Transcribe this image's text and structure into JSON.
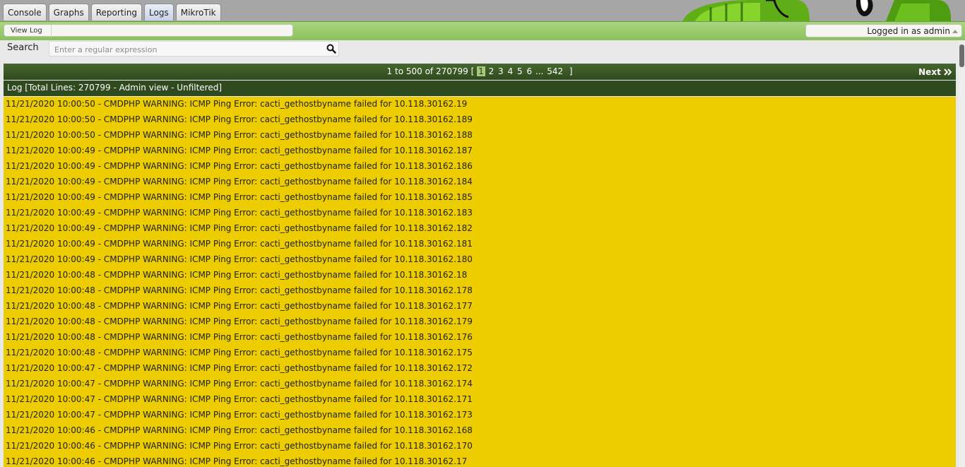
{
  "tabs": [
    {
      "label": "Console",
      "active": false
    },
    {
      "label": "Graphs",
      "active": false
    },
    {
      "label": "Reporting",
      "active": false
    },
    {
      "label": "Logs",
      "active": true
    },
    {
      "label": "MikroTik",
      "active": false
    }
  ],
  "breadcrumb": {
    "current": "View Log"
  },
  "user": {
    "status": "Logged in as admin"
  },
  "search": {
    "label": "Search",
    "placeholder": "Enter a regular expression"
  },
  "pager": {
    "range": "1 to 500 of 270799",
    "open_bracket": "[",
    "close_bracket": "]",
    "current_page": "1",
    "pages": [
      "2",
      "3",
      "4",
      "5",
      "6"
    ],
    "ellipsis": "...",
    "last_page": "542",
    "next_label": "Next"
  },
  "log": {
    "title": "Log [Total Lines: 270799 - Admin view - Unfiltered]",
    "lines": [
      "11/21/2020 10:00:50 - CMDPHP WARNING: ICMP Ping Error: cacti_gethostbyname failed for 10.118.30162.19",
      "11/21/2020 10:00:50 - CMDPHP WARNING: ICMP Ping Error: cacti_gethostbyname failed for 10.118.30162.189",
      "11/21/2020 10:00:50 - CMDPHP WARNING: ICMP Ping Error: cacti_gethostbyname failed for 10.118.30162.188",
      "11/21/2020 10:00:49 - CMDPHP WARNING: ICMP Ping Error: cacti_gethostbyname failed for 10.118.30162.187",
      "11/21/2020 10:00:49 - CMDPHP WARNING: ICMP Ping Error: cacti_gethostbyname failed for 10.118.30162.186",
      "11/21/2020 10:00:49 - CMDPHP WARNING: ICMP Ping Error: cacti_gethostbyname failed for 10.118.30162.184",
      "11/21/2020 10:00:49 - CMDPHP WARNING: ICMP Ping Error: cacti_gethostbyname failed for 10.118.30162.185",
      "11/21/2020 10:00:49 - CMDPHP WARNING: ICMP Ping Error: cacti_gethostbyname failed for 10.118.30162.183",
      "11/21/2020 10:00:49 - CMDPHP WARNING: ICMP Ping Error: cacti_gethostbyname failed for 10.118.30162.182",
      "11/21/2020 10:00:49 - CMDPHP WARNING: ICMP Ping Error: cacti_gethostbyname failed for 10.118.30162.181",
      "11/21/2020 10:00:49 - CMDPHP WARNING: ICMP Ping Error: cacti_gethostbyname failed for 10.118.30162.180",
      "11/21/2020 10:00:48 - CMDPHP WARNING: ICMP Ping Error: cacti_gethostbyname failed for 10.118.30162.18",
      "11/21/2020 10:00:48 - CMDPHP WARNING: ICMP Ping Error: cacti_gethostbyname failed for 10.118.30162.178",
      "11/21/2020 10:00:48 - CMDPHP WARNING: ICMP Ping Error: cacti_gethostbyname failed for 10.118.30162.177",
      "11/21/2020 10:00:48 - CMDPHP WARNING: ICMP Ping Error: cacti_gethostbyname failed for 10.118.30162.179",
      "11/21/2020 10:00:48 - CMDPHP WARNING: ICMP Ping Error: cacti_gethostbyname failed for 10.118.30162.176",
      "11/21/2020 10:00:48 - CMDPHP WARNING: ICMP Ping Error: cacti_gethostbyname failed for 10.118.30162.175",
      "11/21/2020 10:00:47 - CMDPHP WARNING: ICMP Ping Error: cacti_gethostbyname failed for 10.118.30162.172",
      "11/21/2020 10:00:47 - CMDPHP WARNING: ICMP Ping Error: cacti_gethostbyname failed for 10.118.30162.174",
      "11/21/2020 10:00:47 - CMDPHP WARNING: ICMP Ping Error: cacti_gethostbyname failed for 10.118.30162.171",
      "11/21/2020 10:00:47 - CMDPHP WARNING: ICMP Ping Error: cacti_gethostbyname failed for 10.118.30162.173",
      "11/21/2020 10:00:46 - CMDPHP WARNING: ICMP Ping Error: cacti_gethostbyname failed for 10.118.30162.168",
      "11/21/2020 10:00:46 - CMDPHP WARNING: ICMP Ping Error: cacti_gethostbyname failed for 10.118.30162.170",
      "11/21/2020 10:00:46 - CMDPHP WARNING: ICMP Ping Error: cacti_gethostbyname failed for 10.118.30162.17"
    ]
  },
  "icons": {
    "search": "search-icon",
    "next": "double-chevron-right-icon",
    "caret": "caret-up-icon",
    "logo": "cactus-logo-icon"
  },
  "colors": {
    "nav_green": "#8cc05d",
    "header_dark_green": "#2f4a1e",
    "log_background": "#edcc00",
    "current_page": "#a6c77c"
  }
}
